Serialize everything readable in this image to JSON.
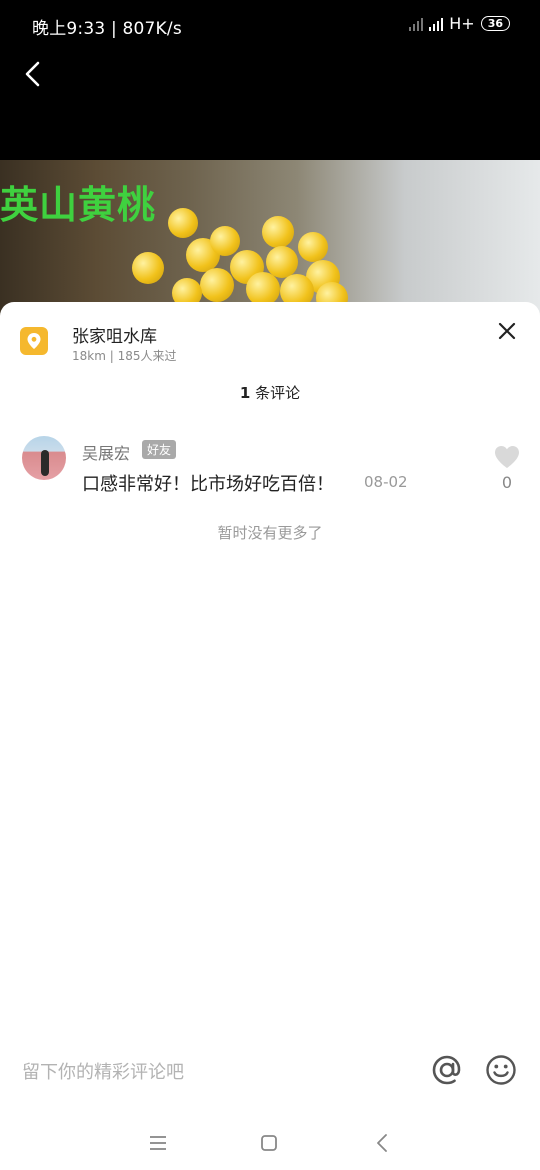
{
  "status_bar": {
    "time_speed": "晚上9:33 | 807K/s",
    "network": "H+",
    "battery": "36"
  },
  "media": {
    "caption": "英山黄桃"
  },
  "location": {
    "name": "张家咀水库",
    "meta": "18km | 185人来过"
  },
  "comments_header": {
    "count": "1",
    "suffix": " 条评论"
  },
  "comments": [
    {
      "user": "吴展宏",
      "badge": "好友",
      "text": "口感非常好！比市场好吃百倍！",
      "date": "08-02",
      "likes": "0"
    }
  ],
  "no_more_text": "暂时没有更多了",
  "composer": {
    "placeholder": "留下你的精彩评论吧"
  },
  "icons": {
    "location": "location-pin-icon",
    "close": "close-icon",
    "like": "heart-icon",
    "mention": "at-icon",
    "emoji": "emoji-icon"
  },
  "colors": {
    "accent_location": "#f5b82e",
    "caption_green": "#3fd13f"
  }
}
